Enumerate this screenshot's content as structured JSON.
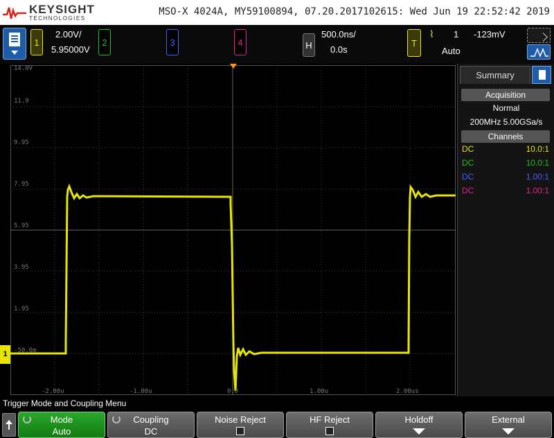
{
  "header": {
    "brand": "KEYSIGHT",
    "brand_sub": "TECHNOLOGIES",
    "instrument_info": "MSO-X 4024A, MY59100894, 07.20.2017102615: Wed Jun 19 22:52:42 2019"
  },
  "channels": {
    "ch1": {
      "label": "1",
      "scale": "2.00V/",
      "offset": "5.95000V",
      "color": "#e6e600"
    },
    "ch2": {
      "label": "2",
      "color": "#22c022"
    },
    "ch3": {
      "label": "3",
      "color": "#4060ff"
    },
    "ch4": {
      "label": "4",
      "color": "#e0208a"
    }
  },
  "horizontal": {
    "label": "H",
    "scale": "500.0ns/",
    "position": "0.0s"
  },
  "trigger": {
    "label": "T",
    "edge_icon": "rising-edge-icon",
    "edge_glyph": "⌇",
    "source": "1",
    "level": "-123mV",
    "mode": "Auto"
  },
  "graticule": {
    "voltage_labels": [
      "14.0V",
      "11.9",
      "9.95",
      "7.95",
      "5.95",
      "3.95",
      "1.95",
      "-50.0m"
    ],
    "time_labels": [
      "-2.00u",
      "-1.00u",
      "0.0",
      "1.00u",
      "2.00us"
    ],
    "ch1_marker": "1"
  },
  "summary_panel": {
    "tab": "Summary",
    "acquisition_title": "Acquisition",
    "acquisition_mode": "Normal",
    "acquisition_rate": "200MHz   5.00GSa/s",
    "channels_title": "Channels",
    "channel_rows": [
      {
        "coupling": "DC",
        "probe": "10.0:1",
        "color": "#e6e600"
      },
      {
        "coupling": "DC",
        "probe": "10.0:1",
        "color": "#22c022"
      },
      {
        "coupling": "DC",
        "probe": "1.00:1",
        "color": "#4060ff"
      },
      {
        "coupling": "DC",
        "probe": "1.00:1",
        "color": "#e0208a"
      }
    ]
  },
  "softkeys": {
    "menu_title": "Trigger Mode and Coupling Menu",
    "keys": [
      {
        "label": "Mode",
        "value": "Auto"
      },
      {
        "label": "Coupling",
        "value": "DC"
      },
      {
        "label": "Noise Reject"
      },
      {
        "label": "HF Reject"
      },
      {
        "label": "Holdoff"
      },
      {
        "label": "External"
      }
    ]
  },
  "colors": {
    "trace": "#e6e600",
    "grid": "#444444",
    "accent": "#1e5ca8",
    "active_key": "#2aa82a"
  }
}
